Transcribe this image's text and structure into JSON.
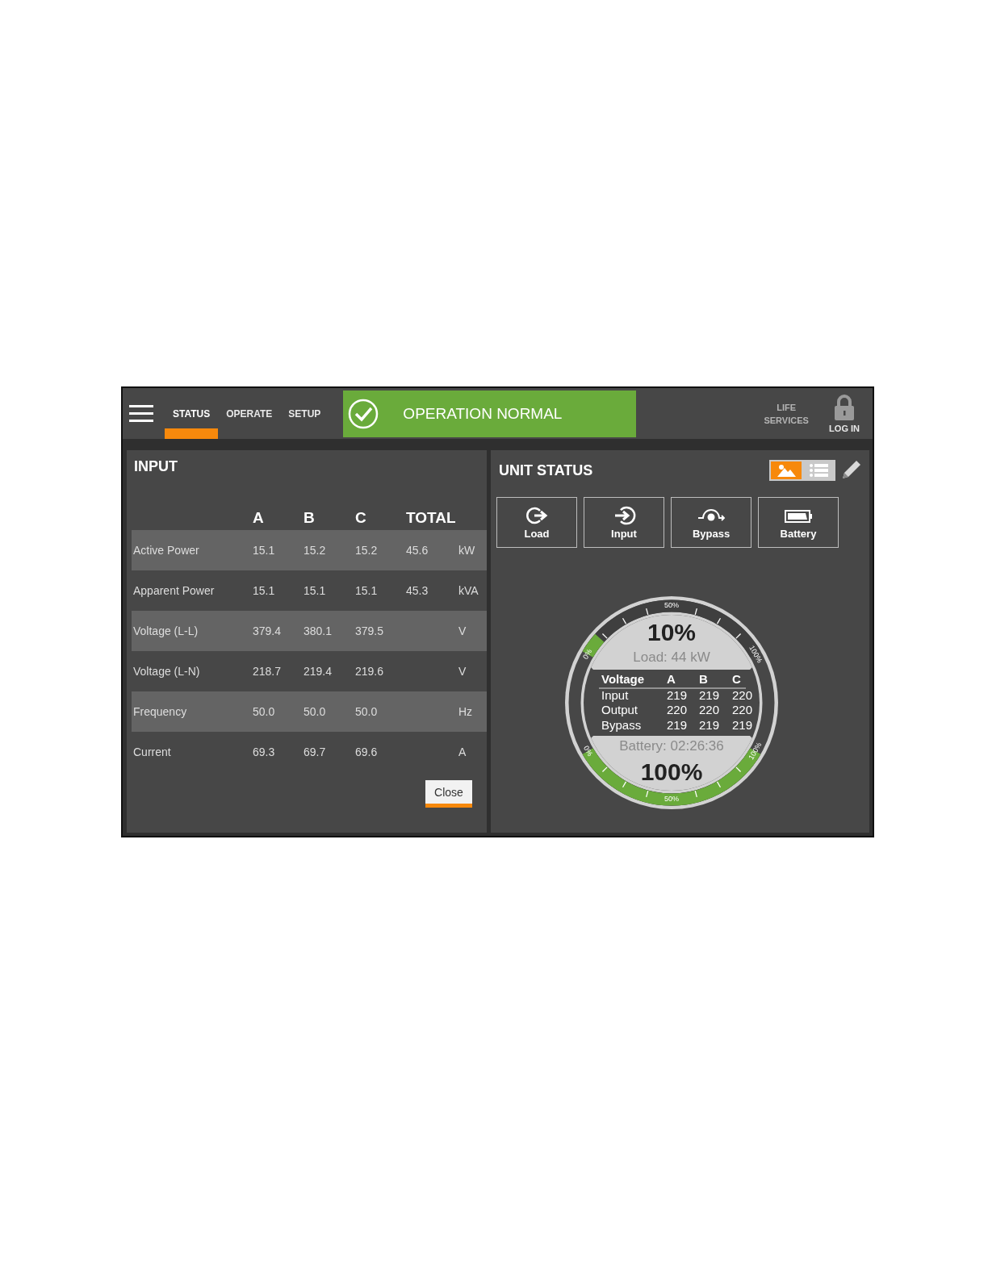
{
  "nav": {
    "tabs": [
      {
        "label": "STATUS",
        "selected": true
      },
      {
        "label": "OPERATE",
        "selected": false
      },
      {
        "label": "SETUP",
        "selected": false
      }
    ]
  },
  "status_banner": {
    "kind": "normal",
    "text": "OPERATION NORMAL"
  },
  "header_right": {
    "life_services": "LIFE SERVICES",
    "login": "LOG IN"
  },
  "input_panel": {
    "title": "INPUT",
    "columns": [
      "A",
      "B",
      "C",
      "TOTAL"
    ],
    "rows": [
      {
        "name": "Active Power",
        "a": "15.1",
        "b": "15.2",
        "c": "15.2",
        "total": "45.6",
        "unit": "kW"
      },
      {
        "name": "Apparent Power",
        "a": "15.1",
        "b": "15.1",
        "c": "15.1",
        "total": "45.3",
        "unit": "kVA"
      },
      {
        "name": "Voltage (L-L)",
        "a": "379.4",
        "b": "380.1",
        "c": "379.5",
        "unit": "V"
      },
      {
        "name": "Voltage (L-N)",
        "a": "218.7",
        "b": "219.4",
        "c": "219.6",
        "unit": "V"
      },
      {
        "name": "Frequency",
        "a": "50.0",
        "b": "50.0",
        "c": "50.0",
        "unit": "Hz"
      },
      {
        "name": "Current",
        "a": "69.3",
        "b": "69.7",
        "c": "69.6",
        "unit": "A"
      }
    ],
    "close": "Close"
  },
  "unit_status": {
    "title": "UNIT STATUS",
    "views": [
      {
        "kind": "diagram",
        "selected": true
      },
      {
        "kind": "list",
        "selected": false
      }
    ],
    "buttons": [
      {
        "kind": "load",
        "label": "Load"
      },
      {
        "kind": "input",
        "label": "Input"
      },
      {
        "kind": "bypass",
        "label": "Bypass"
      },
      {
        "kind": "battery",
        "label": "Battery"
      }
    ],
    "gauge": {
      "load": {
        "value": "10%",
        "caption": "Load: 44 kW",
        "level": 0.1,
        "scale": [
          "0%",
          "50%",
          "100%"
        ]
      },
      "voltage": {
        "columns": [
          "Voltage",
          "A",
          "B",
          "C"
        ],
        "rows": [
          {
            "name": "Input",
            "values": [
              "219",
              "219",
              "220"
            ]
          },
          {
            "name": "Output",
            "values": [
              "220",
              "220",
              "220"
            ]
          },
          {
            "name": "Bypass",
            "values": [
              "219",
              "219",
              "219"
            ]
          }
        ]
      },
      "battery": {
        "caption": "Battery: 02:26:36",
        "value": "100%",
        "level": 1,
        "scale": [
          "0%",
          "50%",
          "100%"
        ]
      }
    }
  }
}
